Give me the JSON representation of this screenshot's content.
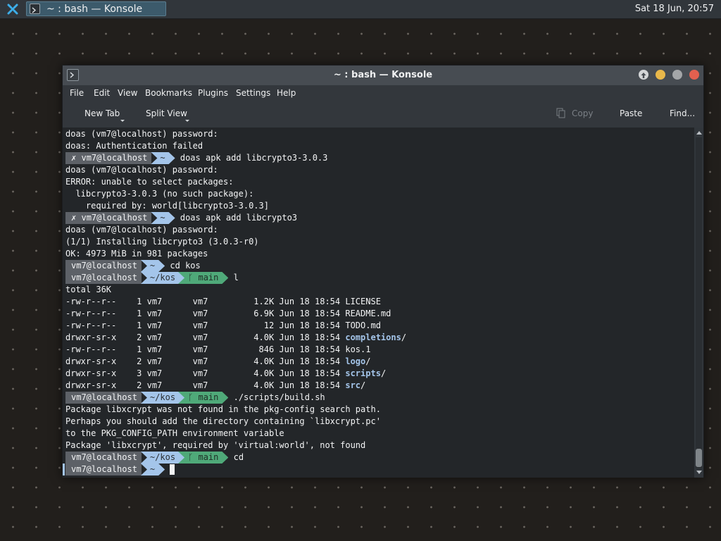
{
  "panel": {
    "task_title": "~ : bash — Konsole",
    "clock": "Sat 18 Jun, 20:57"
  },
  "window": {
    "title": "~ : bash — Konsole",
    "menu": [
      "File",
      "Edit",
      "View",
      "Bookmarks",
      "Plugins",
      "Settings",
      "Help"
    ],
    "toolbar": {
      "new_tab": "New Tab",
      "split_view": "Split View",
      "copy": "Copy",
      "paste": "Paste",
      "find": "Find..."
    }
  },
  "colors": {
    "prompt_user_bg": "#5d6167",
    "prompt_dir_bg": "#a4c5ea",
    "prompt_git_bg": "#4fa979",
    "dir_listing": "#a4c5ea",
    "terminal_bg": "#232629"
  },
  "terminal": {
    "l0": "doas (vm7@localhost) password:",
    "l1": "doas: Authentication failed",
    "p2": {
      "mark": "✗",
      "user": "vm7@localhost",
      "dir": "~",
      "cmd": "doas apk add libcrypto3-3.0.3"
    },
    "l3": "doas (vm7@localhost) password:",
    "l4": "ERROR: unable to select packages:",
    "l5": "  libcrypto3-3.0.3 (no such package):",
    "l6": "    required by: world[libcrypto3-3.0.3]",
    "p7": {
      "mark": "✗",
      "user": "vm7@localhost",
      "dir": "~",
      "cmd": "doas apk add libcrypto3"
    },
    "l8": "doas (vm7@localhost) password:",
    "l9": "(1/1) Installing libcrypto3 (3.0.3-r0)",
    "l10": "OK: 4973 MiB in 981 packages",
    "p11": {
      "user": "vm7@localhost",
      "dir": "~",
      "cmd": "cd kos"
    },
    "p12": {
      "user": "vm7@localhost",
      "dir": "~/kos",
      "git": "ᚴ main",
      "cmd": "l"
    },
    "l13": "total 36K",
    "ls": [
      {
        "perm": "-rw-r--r--    1 vm7      vm7         1.2K Jun 18 18:54 ",
        "name": "LICENSE",
        "suffix": "",
        "dir": false
      },
      {
        "perm": "-rw-r--r--    1 vm7      vm7         6.9K Jun 18 18:54 ",
        "name": "README.md",
        "suffix": "",
        "dir": false
      },
      {
        "perm": "-rw-r--r--    1 vm7      vm7           12 Jun 18 18:54 ",
        "name": "TODO.md",
        "suffix": "",
        "dir": false
      },
      {
        "perm": "drwxr-sr-x    2 vm7      vm7         4.0K Jun 18 18:54 ",
        "name": "completions",
        "suffix": "/",
        "dir": true
      },
      {
        "perm": "-rw-r--r--    1 vm7      vm7          846 Jun 18 18:54 ",
        "name": "kos.1",
        "suffix": "",
        "dir": false
      },
      {
        "perm": "drwxr-sr-x    2 vm7      vm7         4.0K Jun 18 18:54 ",
        "name": "logo",
        "suffix": "/",
        "dir": true
      },
      {
        "perm": "drwxr-sr-x    3 vm7      vm7         4.0K Jun 18 18:54 ",
        "name": "scripts",
        "suffix": "/",
        "dir": true
      },
      {
        "perm": "drwxr-sr-x    2 vm7      vm7         4.0K Jun 18 18:54 ",
        "name": "src",
        "suffix": "/",
        "dir": true
      }
    ],
    "p22": {
      "user": "vm7@localhost",
      "dir": "~/kos",
      "git": "ᚴ main",
      "cmd": "./scripts/build.sh"
    },
    "l23": "Package libxcrypt was not found in the pkg-config search path.",
    "l24": "Perhaps you should add the directory containing `libxcrypt.pc'",
    "l25": "to the PKG_CONFIG_PATH environment variable",
    "l26": "Package 'libxcrypt', required by 'virtual:world', not found",
    "p27": {
      "user": "vm7@localhost",
      "dir": "~/kos",
      "git": "ᚴ main",
      "cmd": "cd"
    },
    "p28": {
      "user": "vm7@localhost",
      "dir": "~",
      "cmd": ""
    }
  }
}
